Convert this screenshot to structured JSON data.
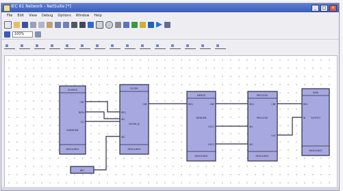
{
  "window": {
    "title": "IEC 61 Network - NetSuite [*]"
  },
  "menu": [
    "File",
    "Edit",
    "View",
    "Debug",
    "Options",
    "Window",
    "Help"
  ],
  "toolbar": {
    "zoom_value": "100%"
  },
  "colors": {
    "block_fill": "#a8a8e0",
    "block_stroke": "#2a2a48",
    "wire": "#2a2a48",
    "titlebar": "#4a6cc8"
  },
  "blocks": [
    {
      "id": "source",
      "header": "SOURCE",
      "name": "SUBNODE",
      "footer": "RESOURCE",
      "inputs": [],
      "outputs": [
        "CNF",
        "DATA",
        "QO"
      ]
    },
    {
      "id": "filter",
      "header": "FILTER",
      "name": "FILTER_B",
      "footer": "RESOURCE",
      "inputs": [
        "REQ",
        "IN1",
        "IN2"
      ],
      "outputs": [
        "CNF"
      ]
    },
    {
      "id": "merge",
      "header": "MERGE",
      "name": "MERGEB",
      "footer": "RESOURCE",
      "inputs": [
        "REQ",
        "IN",
        "EN"
      ],
      "outputs": [
        "CNF",
        "OUT1",
        "OUT2"
      ]
    },
    {
      "id": "process",
      "header": "PROCESS",
      "name": "PROCESS",
      "footer": "RESOURCE",
      "inputs": [
        "REQ",
        "IN1",
        "IN2"
      ],
      "outputs": [
        "CNF",
        "OUT"
      ]
    },
    {
      "id": "sink",
      "header": "SINK",
      "name": "OUTPUT",
      "footer": "RESOURCE",
      "inputs": [
        "REQ",
        "IN"
      ],
      "outputs": []
    },
    {
      "id": "const",
      "header": "INIT",
      "name": "",
      "footer": "",
      "inputs": [],
      "outputs": []
    }
  ]
}
